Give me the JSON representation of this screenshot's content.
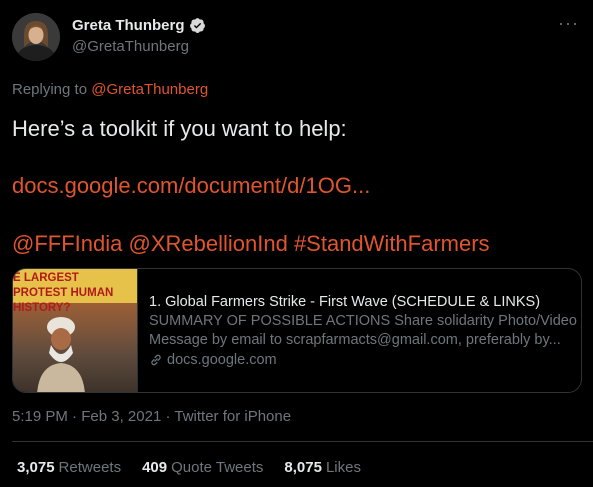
{
  "author": {
    "display_name": "Greta Thunberg",
    "handle": "@GretaThunberg",
    "verified": true
  },
  "icons": [
    "avatar",
    "verified-badge-icon",
    "more-options-icon",
    "link-icon"
  ],
  "colors": {
    "link": "#e0552e",
    "muted": "#6e767d",
    "text": "#e7e9ea",
    "background": "#000000"
  },
  "reply": {
    "prefix": "Replying to",
    "mention": "@GretaThunberg"
  },
  "body": {
    "line1": "Here’s a toolkit if you want to help:",
    "link": "docs.google.com/document/d/1OG...",
    "tags": [
      "@FFFIndia",
      "@XRebellionInd",
      "#StandWithFarmers"
    ]
  },
  "card": {
    "thumb_text": "E LARGEST PROTEST HUMAN HISTORY?",
    "title": "1. Global Farmers Strike - First Wave (SCHEDULE & LINKS)",
    "desc1": "SUMMARY OF POSSIBLE ACTIONS Share solidarity Photo/Video",
    "desc2": "Message by email to scrapfarmacts@gmail.com, preferably by...",
    "domain": "docs.google.com"
  },
  "meta": {
    "time": "5:19 PM",
    "date": "Feb 3, 2021",
    "source": "Twitter for iPhone"
  },
  "stats": {
    "retweets": "3,075",
    "retweets_label": "Retweets",
    "quotes": "409",
    "quotes_label": "Quote Tweets",
    "likes": "8,075",
    "likes_label": "Likes"
  }
}
